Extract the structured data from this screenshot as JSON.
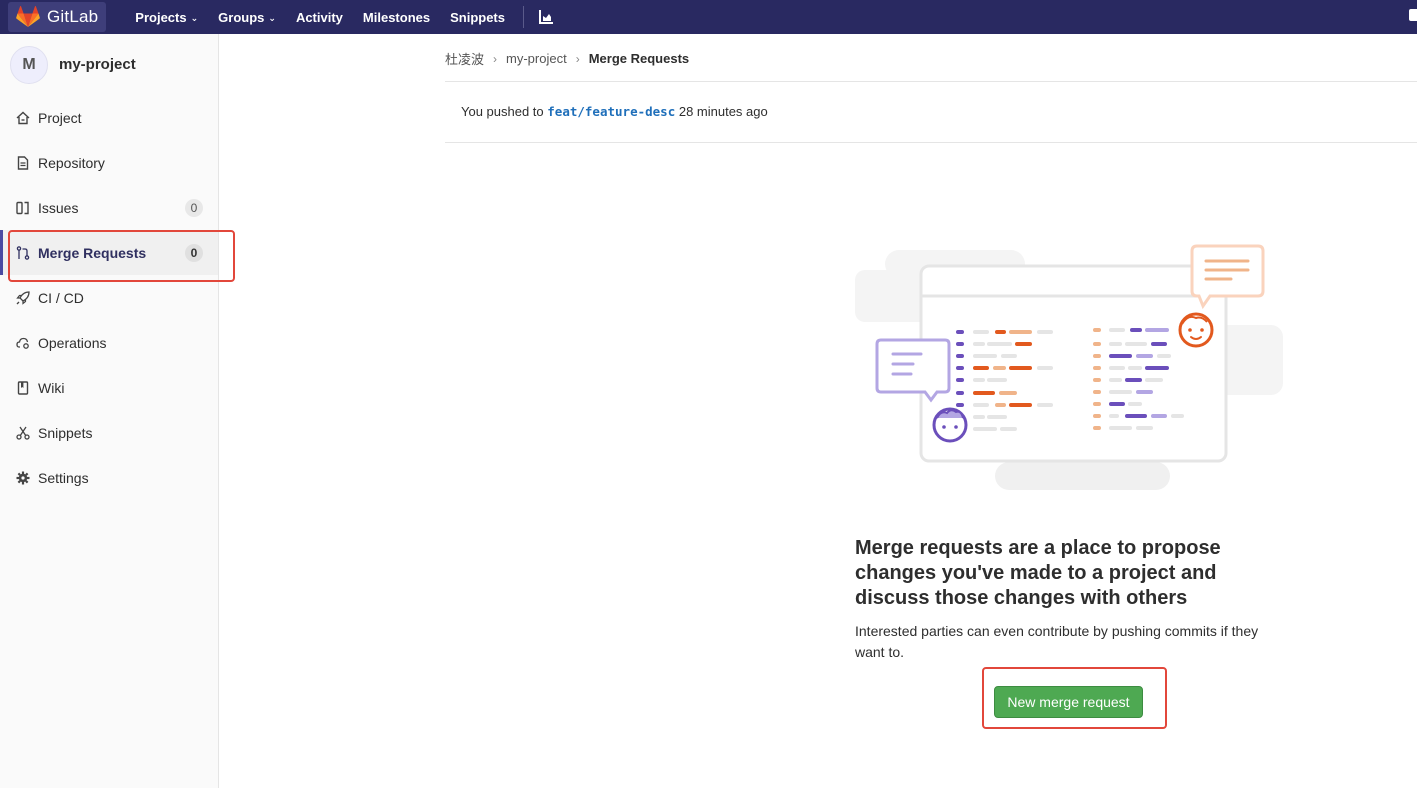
{
  "navbar": {
    "brand": "GitLab",
    "links": [
      {
        "label": "Projects",
        "dropdown": true
      },
      {
        "label": "Groups",
        "dropdown": true
      },
      {
        "label": "Activity",
        "dropdown": false
      },
      {
        "label": "Milestones",
        "dropdown": false
      },
      {
        "label": "Snippets",
        "dropdown": false
      }
    ],
    "chart_icon": "chart-icon"
  },
  "sidebar": {
    "avatar_letter": "M",
    "project_name": "my-project",
    "items": [
      {
        "label": "Project",
        "icon": "home-icon"
      },
      {
        "label": "Repository",
        "icon": "document-icon"
      },
      {
        "label": "Issues",
        "icon": "issues-icon",
        "count": "0"
      },
      {
        "label": "Merge Requests",
        "icon": "merge-request-icon",
        "count": "0",
        "active": true
      },
      {
        "label": "CI / CD",
        "icon": "rocket-icon"
      },
      {
        "label": "Operations",
        "icon": "cloud-gear-icon"
      },
      {
        "label": "Wiki",
        "icon": "book-icon"
      },
      {
        "label": "Snippets",
        "icon": "scissors-icon"
      },
      {
        "label": "Settings",
        "icon": "gear-icon"
      }
    ]
  },
  "breadcrumb": {
    "items": [
      "杜凌波",
      "my-project",
      "Merge Requests"
    ]
  },
  "push_notice": {
    "prefix": "You pushed to",
    "branch": "feat/feature-desc",
    "suffix": "28 minutes ago"
  },
  "empty_state": {
    "title": "Merge requests are a place to propose changes you've made to a project and discuss those changes with others",
    "description": "Interested parties can even contribute by pushing commits if they want to.",
    "button_label": "New merge request"
  },
  "colors": {
    "navbar": "#292961",
    "active_accent": "#4b4ba3",
    "button_green": "#4ea952",
    "annotation_red": "#e2473b"
  }
}
